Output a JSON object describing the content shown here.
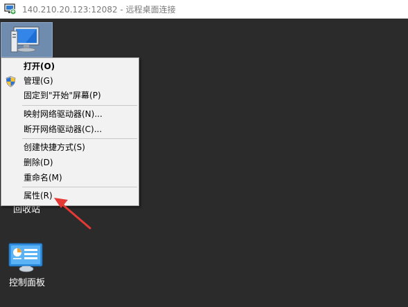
{
  "window": {
    "title": "140.210.20.123:12082 - 远程桌面连接",
    "icon": "remote-desktop-icon"
  },
  "desktop": {
    "icons": [
      {
        "name": "this-pc",
        "label": "",
        "icon": "computer-icon",
        "selected": true
      },
      {
        "name": "recycle-bin",
        "label": "回收站",
        "icon": "recycle-bin-icon"
      },
      {
        "name": "control-panel",
        "label": "控制面板",
        "icon": "control-panel-icon"
      }
    ]
  },
  "context_menu": {
    "items": [
      {
        "label": "打开(O)",
        "bold": true
      },
      {
        "label": "管理(G)",
        "icon": "shield-icon"
      },
      {
        "label": "固定到\"开始\"屏幕(P)"
      },
      {
        "label": "映射网络驱动器(N)..."
      },
      {
        "label": "断开网络驱动器(C)..."
      },
      {
        "label": "创建快捷方式(S)"
      },
      {
        "label": "删除(D)"
      },
      {
        "label": "重命名(M)"
      },
      {
        "label": "属性(R)",
        "highlighted_by_arrow": true
      }
    ]
  },
  "colors": {
    "desktop_bg": "#2b2b2b",
    "menu_bg": "#f2f2f2",
    "selection": "#6f8caf",
    "annotation_arrow": "#e53935"
  },
  "annotation": {
    "type": "arrow",
    "points_to": "属性(R)"
  }
}
